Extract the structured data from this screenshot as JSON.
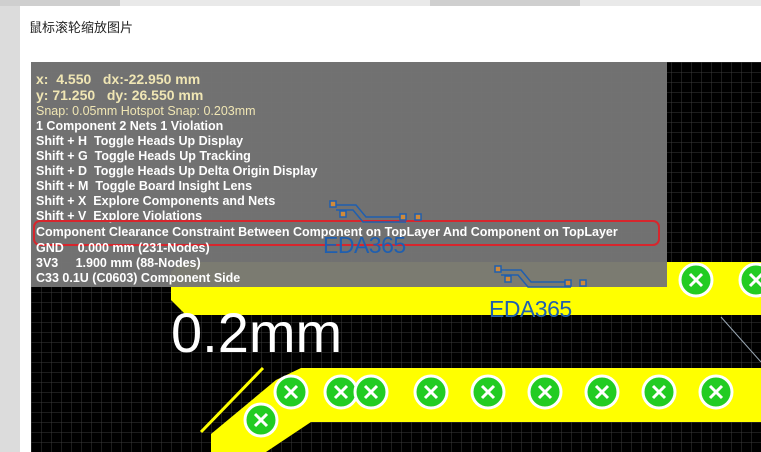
{
  "dialog": {
    "title": "鼠标滚轮缩放图片"
  },
  "hud": {
    "coord_x": "x:  4.550   dx:-22.950 mm",
    "coord_y": "y: 71.250   dy: 26.550 mm",
    "snap": "Snap: 0.05mm Hotspot Snap: 0.203mm",
    "summary": "1 Component 2 Nets 1 Violation",
    "shortcuts": [
      "Shift + H  Toggle Heads Up Display",
      "Shift + G  Toggle Heads Up Tracking",
      "Shift + D  Toggle Heads Up Delta Origin Display",
      "Shift + M  Toggle Board Insight Lens",
      "Shift + X  Explore Components and Nets",
      "Shift + V  Explore Violations"
    ],
    "violation": "Component Clearance Constraint Between Component on TopLayer And Component on TopLayer",
    "nets": [
      "GND    0.000 mm (231-Nodes)",
      "3V3     1.900 mm (88-Nodes)"
    ],
    "component": "C33 0.1U (C0603) Component Side"
  },
  "watermarks": [
    "EDA365",
    "EDA365"
  ],
  "pcb": {
    "dimension_label": "0.2mm"
  },
  "colors": {
    "copper": "#ffff00",
    "pad": "#22cc22",
    "grid": "#3a3a3a",
    "violation_outline": "#d7262d",
    "watermark": "#1f5fb0"
  }
}
